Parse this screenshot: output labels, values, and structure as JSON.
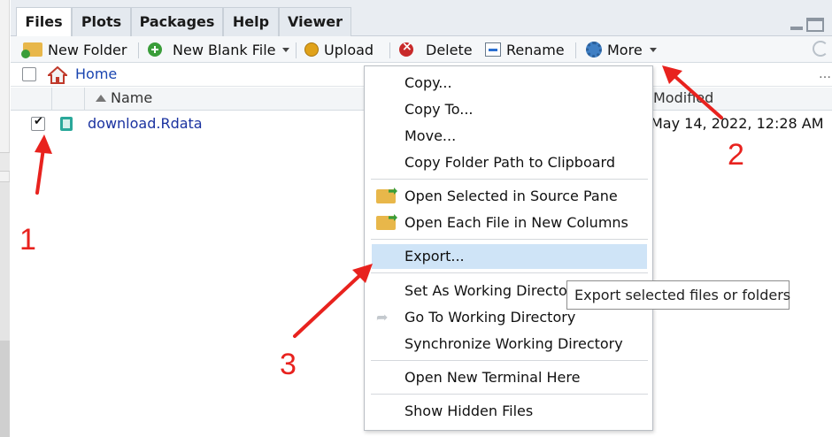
{
  "tabs": [
    "Files",
    "Plots",
    "Packages",
    "Help",
    "Viewer"
  ],
  "active_tab": "Files",
  "toolbar": {
    "new_folder": "New Folder",
    "new_blank_file": "New Blank File",
    "upload": "Upload",
    "delete": "Delete",
    "rename": "Rename",
    "more": "More"
  },
  "path": {
    "home": "Home"
  },
  "columns": {
    "name": "Name",
    "modified": "Modified"
  },
  "files": [
    {
      "name": "download.Rdata",
      "modified": "May 14, 2022, 12:28 AM",
      "checked": true
    }
  ],
  "menu": {
    "copy": "Copy...",
    "copy_to": "Copy To...",
    "move": "Move...",
    "copy_path": "Copy Folder Path to Clipboard",
    "open_selected": "Open Selected in Source Pane",
    "open_each": "Open Each File in New Columns",
    "export": "Export...",
    "set_wd": "Set As Working Directo",
    "goto_wd": "Go To Working Directory",
    "sync_wd": "Synchronize Working Directory",
    "terminal": "Open New Terminal Here",
    "show_hidden": "Show Hidden Files"
  },
  "tooltip": "Export selected files or folders",
  "annotations": {
    "n1": "1",
    "n2": "2",
    "n3": "3"
  },
  "colors": {
    "accent": "#1a45b0",
    "highlight": "#cfe4f7",
    "annotation": "#e8221e"
  }
}
